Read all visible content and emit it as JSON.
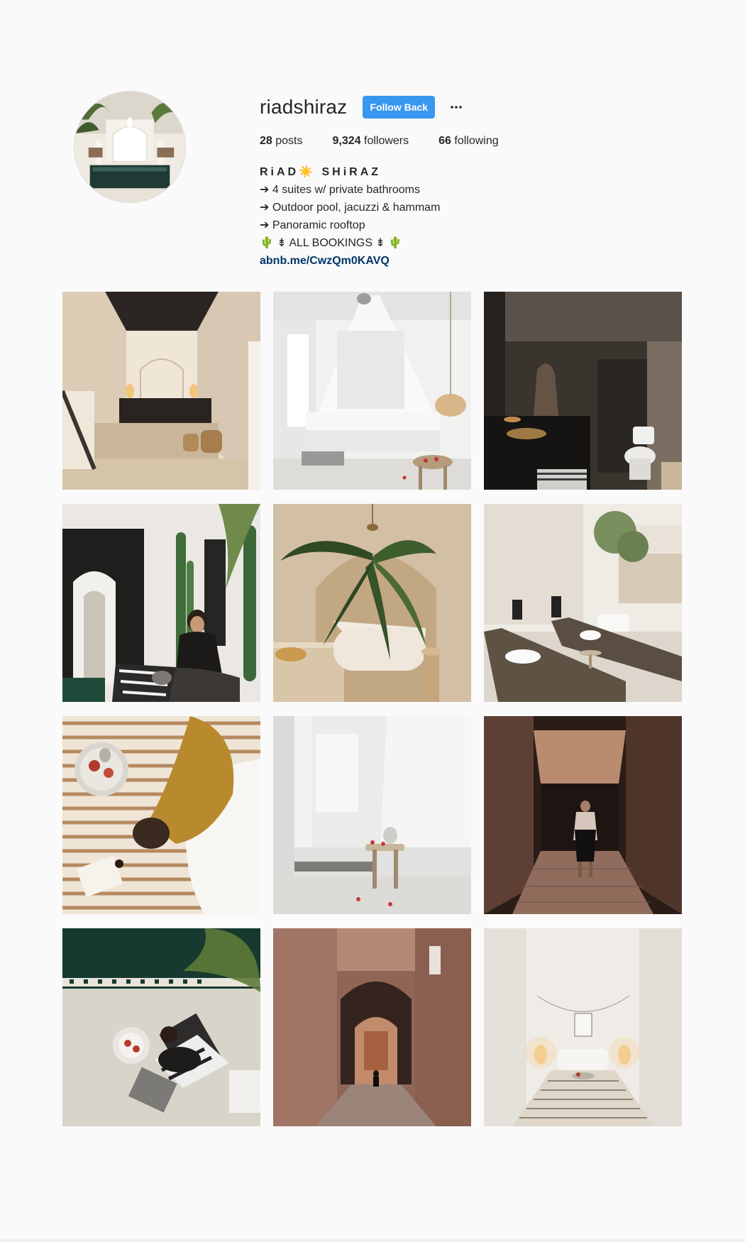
{
  "profile": {
    "username": "riadshiraz",
    "follow_label": "Follow Back",
    "more_icon": "more-horizontal-icon",
    "stats": {
      "posts_count": "28",
      "posts_label": "posts",
      "followers_count": "9,324",
      "followers_label": "followers",
      "following_count": "66",
      "following_label": "following"
    },
    "bio": {
      "name": "RiAD☀️ SHiRAZ",
      "lines": [
        "➔ 4 suites w/ private bathrooms",
        "➔ Outdoor pool, jacuzzi & hammam",
        "➔ Panoramic rooftop",
        "🌵 ⇟ ALL BOOKINGS ⇟ 🌵"
      ],
      "link": "abnb.me/CwzQm0KAVQ"
    }
  },
  "posts": [
    {
      "scene": "bedroom-dark-ceiling"
    },
    {
      "scene": "white-canopy-bed"
    },
    {
      "scene": "dark-tadelakt-bathroom"
    },
    {
      "scene": "woman-with-cat-courtyard"
    },
    {
      "scene": "bathtub-with-palm"
    },
    {
      "scene": "rooftop-loungers"
    },
    {
      "scene": "woman-reading-on-bed"
    },
    {
      "scene": "hazy-canopy-bedroom"
    },
    {
      "scene": "woman-in-dark-alley"
    },
    {
      "scene": "overhead-woman-tiles"
    },
    {
      "scene": "medina-arch-alley"
    },
    {
      "scene": "striped-bed-lamps"
    }
  ],
  "colors": {
    "background": "#fafafa",
    "follow_button": "#3897f0",
    "link": "#003569",
    "text": "#262626"
  }
}
